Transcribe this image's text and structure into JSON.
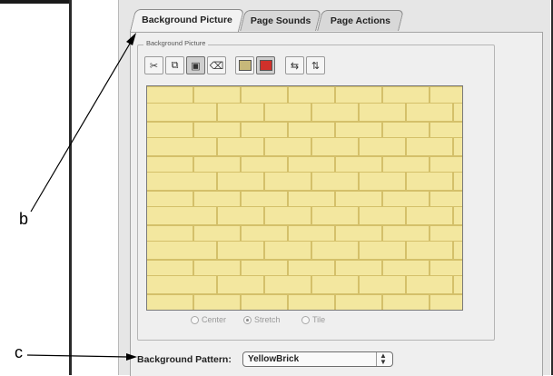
{
  "callouts": {
    "b": "b",
    "c": "c"
  },
  "tabs": [
    {
      "label": "Background Picture",
      "active": true
    },
    {
      "label": "Page Sounds",
      "active": false
    },
    {
      "label": "Page Actions",
      "active": false
    }
  ],
  "group": {
    "label": "Background Picture"
  },
  "toolbar": {
    "icons": [
      "cut-icon",
      "copy-icon",
      "paste-icon",
      "clear-icon",
      "choose-image-icon",
      "color-swatch-icon",
      "flip-horizontal-icon",
      "flip-vertical-icon"
    ]
  },
  "placement_options": [
    {
      "label": "Center",
      "selected": false
    },
    {
      "label": "Stretch",
      "selected": true
    },
    {
      "label": "Tile",
      "selected": false
    }
  ],
  "pattern": {
    "label": "Background Pattern:",
    "value": "YellowBrick"
  },
  "colors": {
    "brick_fill": "#f3e79f",
    "brick_mortar": "#d4c06a",
    "window_bg": "#e6e6e6"
  }
}
